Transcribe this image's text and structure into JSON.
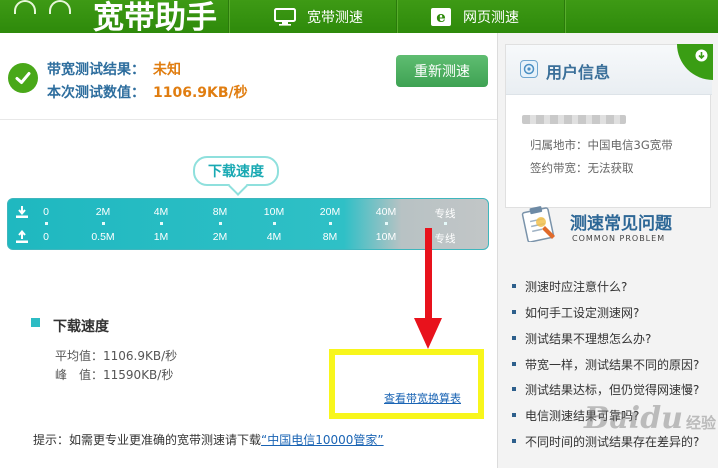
{
  "header": {
    "app_title": "宽带助手",
    "tabs": [
      {
        "label": "宽带测速",
        "icon": "monitor-icon"
      },
      {
        "label": "网页测速",
        "icon": "browser-e-icon"
      }
    ]
  },
  "result": {
    "status_label": "带宽测试结果：",
    "status_value": "未知",
    "speed_label": "本次测试数值：",
    "speed_value": "1106.9KB/秒",
    "retest_label": "重新测速"
  },
  "gauge": {
    "bubble_label": "下载速度",
    "download_ticks": [
      "0",
      "2M",
      "4M",
      "8M",
      "10M",
      "20M",
      "40M",
      "专线"
    ],
    "upload_ticks": [
      "0",
      "0.5M",
      "1M",
      "2M",
      "4M",
      "8M",
      "10M",
      "专线"
    ]
  },
  "detail": {
    "title": "下载速度",
    "avg_label": "平均值：",
    "avg_value": "1106.9KB/秒",
    "peak_label": "峰　值：",
    "peak_value": "11590KB/秒",
    "rate_table_link": "查看带宽换算表"
  },
  "tip": {
    "text": "提示：如需更专业更准确的宽带测速请下载",
    "link": "“中国电信10000管家”"
  },
  "user_info": {
    "title": "用户信息",
    "location": "归属地市：中国电信3G宽带",
    "bandwidth": "签约带宽：无法获取"
  },
  "faq": {
    "title": "测速常见问题",
    "subtitle": "COMMON PROBLEM",
    "items": [
      "测速时应注意什么?",
      "如何手工设定测速网?",
      "测试结果不理想怎么办?",
      "带宽一样，测试结果不同的原因?",
      "测试结果达标，但仍觉得网速慢?",
      "电信测速结果可靠吗?",
      "不同时间的测试结果存在差异的?"
    ]
  },
  "watermark": {
    "text": "Baidu",
    "suffix": "经验"
  },
  "colors": {
    "header_green": "#3e9a15",
    "accent_teal": "#1fb8c0",
    "value_orange": "#e07d10",
    "link_blue": "#1a64b4",
    "annotation_yellow": "#f8f61c",
    "annotation_red": "#e8121c"
  }
}
